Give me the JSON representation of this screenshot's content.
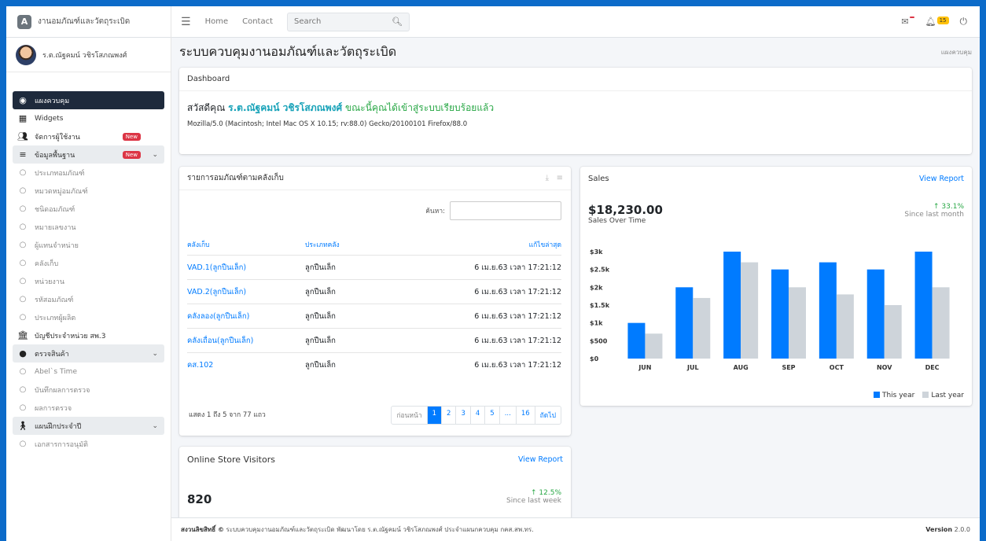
{
  "brand": {
    "logo": "A",
    "name": "งานอมภัณฑ์และวัตถุระเบิด"
  },
  "topnav": {
    "home": "Home",
    "contact": "Contact",
    "search_placeholder": "Search",
    "notif_badge": "",
    "alert_badge": "15"
  },
  "user": {
    "name": "ร.ต.ณัฐคมน์ วชิรโสภณพงศ์"
  },
  "sidebar": {
    "items": [
      {
        "label": "แผงควบคุม",
        "icon": "dashboard-icon"
      },
      {
        "label": "Widgets",
        "icon": "grid-icon"
      },
      {
        "label": "จัดการผู้ใช้งาน",
        "icon": "users-icon",
        "badge": "New"
      },
      {
        "label": "ข้อมูลพื้นฐาน",
        "icon": "database-icon",
        "badge": "New"
      },
      {
        "label": "ประเภทอมภัณฑ์",
        "icon": "circle-icon"
      },
      {
        "label": "หมวดหมู่อมภัณฑ์",
        "icon": "circle-icon"
      },
      {
        "label": "ชนิดอมภัณฑ์",
        "icon": "circle-icon"
      },
      {
        "label": "หมายเลขงาน",
        "icon": "circle-icon"
      },
      {
        "label": "ผู้แทนจำหน่าย",
        "icon": "circle-icon"
      },
      {
        "label": "คลังเก็บ",
        "icon": "circle-icon"
      },
      {
        "label": "หน่วยงาน",
        "icon": "circle-icon"
      },
      {
        "label": "รหัสอมภัณฑ์",
        "icon": "circle-icon"
      },
      {
        "label": "ประเภทผู้ผลิต",
        "icon": "circle-icon"
      },
      {
        "label": "บัญชีประจำหน่วย สพ.3",
        "icon": "building-icon"
      },
      {
        "label": "ตรวจสินค้า",
        "icon": "bomb-icon"
      },
      {
        "label": "Abel`s Time",
        "icon": "circle-icon"
      },
      {
        "label": "บันทึกผลการตรวจ",
        "icon": "circle-icon"
      },
      {
        "label": "ผลการตรวจ",
        "icon": "circle-icon"
      },
      {
        "label": "แผนฝึกประจำปี",
        "icon": "person-icon"
      },
      {
        "label": "เอกสารการอนุมัติ",
        "icon": "circle-icon"
      }
    ]
  },
  "page": {
    "title": "ระบบควบคุมงานอมภัณฑ์และวัตถุระเบิด",
    "breadcrumb": "แผงควบคุม"
  },
  "dashboard": {
    "header": "Dashboard",
    "greet": "สวัสดีคุณ",
    "name": "ร.ต.ณัฐคมน์ วชิรโสภณพงศ์",
    "msg": "ขณะนี้คุณได้เข้าสู่ระบบเรียบร้อยแล้ว",
    "ua": "Mozilla/5.0 (Macintosh; Intel Mac OS X 10.15; rv:88.0) Gecko/20100101 Firefox/88.0"
  },
  "inventory": {
    "title": "รายการอมภัณฑ์ตามคลังเก็บ",
    "search_label": "ค้นหา:",
    "columns": [
      "คลังเก็บ",
      "ประเภทคลัง",
      "แก้ไขล่าสุด"
    ],
    "rows": [
      [
        "VAD.1(ลูกปืนเล็ก)",
        "ลูกปืนเล็ก",
        "6 เม.ย.63 เวลา 17:21:12"
      ],
      [
        "VAD.2(ลูกปืนเล็ก)",
        "ลูกปืนเล็ก",
        "6 เม.ย.63 เวลา 17:21:12"
      ],
      [
        "คลังลอง(ลูกปืนเล็ก)",
        "ลูกปืนเล็ก",
        "6 เม.ย.63 เวลา 17:21:12"
      ],
      [
        "คลังเถื่อน(ลูกปืนเล็ก)",
        "ลูกปืนเล็ก",
        "6 เม.ย.63 เวลา 17:21:12"
      ],
      [
        "คส.102",
        "ลูกปืนเล็ก",
        "6 เม.ย.63 เวลา 17:21:12"
      ]
    ],
    "info": "แสดง 1 ถึง 5 จาก 77 แถว",
    "pager": [
      "ก่อนหน้า",
      "1",
      "2",
      "3",
      "4",
      "5",
      "...",
      "16",
      "ถัดไป"
    ]
  },
  "sales": {
    "title": "Sales",
    "link": "View Report",
    "amount": "$18,230.00",
    "sub": "Sales Over Time",
    "change": "↑ 33.1%",
    "since": "Since last month"
  },
  "chart_data": {
    "type": "bar",
    "categories": [
      "JUN",
      "JUL",
      "AUG",
      "SEP",
      "OCT",
      "NOV",
      "DEC"
    ],
    "series": [
      {
        "name": "This year",
        "values": [
          1000,
          2000,
          3000,
          2500,
          2700,
          2500,
          3000
        ],
        "color": "#007bff"
      },
      {
        "name": "Last year",
        "values": [
          700,
          1700,
          2700,
          2000,
          1800,
          1500,
          2000
        ],
        "color": "#ced4da"
      }
    ],
    "yticks": [
      "$0",
      "$500",
      "$1k",
      "$1.5k",
      "$2k",
      "$2.5k",
      "$3k"
    ],
    "ylim": [
      0,
      3000
    ],
    "grid": false,
    "legend": "bottom-right"
  },
  "visitors": {
    "title": "Online Store Visitors",
    "link": "View Report",
    "count": "820",
    "change": "↑ 12.5%",
    "since": "Since last week"
  },
  "footer": {
    "copyright_label": "สงวนลิขสิทธิ์ ©",
    "copyright": "ระบบควบคุมงานอมภัณฑ์และวัตถุระเบิด พัฒนาโดย ร.ต.ณัฐคมน์ วชิรโสภณพงศ์ ประจำแผนกควบคุม กคส.สพ.ทร.",
    "version_label": "Version",
    "version": "2.0.0"
  }
}
